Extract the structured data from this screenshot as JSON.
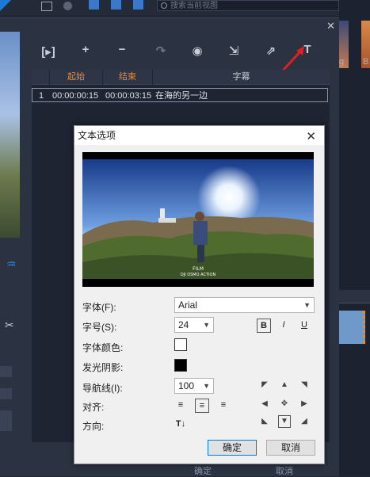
{
  "app": {
    "search_placeholder": "搜索当前视图",
    "toolbar_icons": [
      "insert-media-icon",
      "add-icon",
      "remove-icon",
      "redo-icon",
      "eye-icon",
      "export-icon",
      "import-icon",
      "text-options-icon"
    ]
  },
  "subtitle_table": {
    "headers": {
      "start": "起始",
      "end": "结束",
      "subtitle": "字幕"
    },
    "rows": [
      {
        "index": "1",
        "start": "00:00:00:15",
        "end": "00:00:03:15",
        "text": "在海的另一边"
      }
    ]
  },
  "background_buttons": {
    "ok": "确定",
    "cancel": "取消"
  },
  "thumbnail_labels": [
    "g",
    "B"
  ],
  "dialog": {
    "title": "文本选项",
    "close_glyph": "✕",
    "font_label": "字体(F):",
    "font_value": "Arial",
    "size_label": "字号(S):",
    "size_value": "24",
    "color_label": "字体颜色:",
    "glow_label": "发光阴影:",
    "line_label": "导航线(I):",
    "line_value": "100",
    "align_label": "对齐:",
    "direction_label": "方向:",
    "bold": "B",
    "italic": "I",
    "underline": "U",
    "ok_button": "确定",
    "cancel_button": "取消",
    "watermark_logo": "FILM\nDJI OSMO ACTION",
    "colors": {
      "font": "#ffffff",
      "glow": "#000000"
    }
  }
}
